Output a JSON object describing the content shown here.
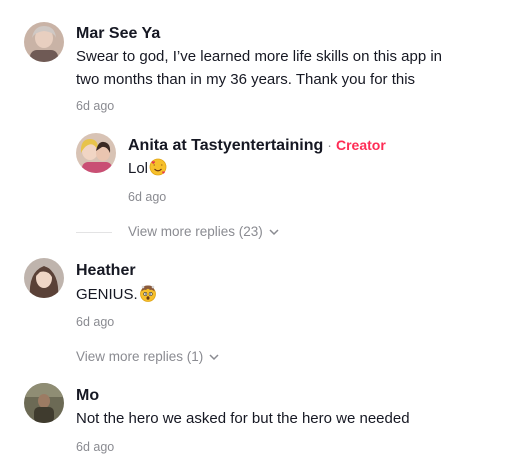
{
  "comments": [
    {
      "author": "Mar See Ya",
      "text_line1": "Swear to god, I’ve learned more life skills on this app in",
      "text_line2": "two months than in my 36 years. Thank you for this",
      "time": "6d ago",
      "reply": {
        "author": "Anita at Tastyentertaining",
        "separator": "·",
        "badge": "Creator",
        "text": "Lol",
        "emoji": "smiling-face-with-hearts",
        "time": "6d ago"
      },
      "view_more": "View more replies (23)"
    },
    {
      "author": "Heather",
      "text": "GENIUS.",
      "emoji": "exploding-head",
      "time": "6d ago",
      "view_more": "View more replies (1)"
    },
    {
      "author": "Mo",
      "text": "Not the hero we asked for but the hero we needed",
      "time": "6d ago"
    }
  ],
  "colors": {
    "creator": "#fe2c55",
    "secondary_text": "#8a8b91",
    "primary_text": "#161823"
  }
}
